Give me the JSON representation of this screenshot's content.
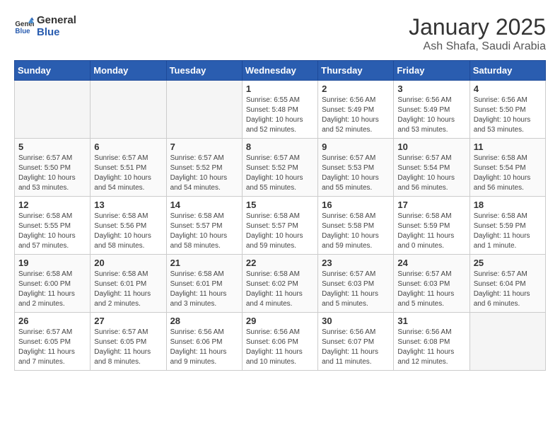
{
  "logo": {
    "line1": "General",
    "line2": "Blue"
  },
  "title": "January 2025",
  "location": "Ash Shafa, Saudi Arabia",
  "weekdays": [
    "Sunday",
    "Monday",
    "Tuesday",
    "Wednesday",
    "Thursday",
    "Friday",
    "Saturday"
  ],
  "weeks": [
    [
      {
        "day": "",
        "info": ""
      },
      {
        "day": "",
        "info": ""
      },
      {
        "day": "",
        "info": ""
      },
      {
        "day": "1",
        "info": "Sunrise: 6:55 AM\nSunset: 5:48 PM\nDaylight: 10 hours\nand 52 minutes."
      },
      {
        "day": "2",
        "info": "Sunrise: 6:56 AM\nSunset: 5:49 PM\nDaylight: 10 hours\nand 52 minutes."
      },
      {
        "day": "3",
        "info": "Sunrise: 6:56 AM\nSunset: 5:49 PM\nDaylight: 10 hours\nand 53 minutes."
      },
      {
        "day": "4",
        "info": "Sunrise: 6:56 AM\nSunset: 5:50 PM\nDaylight: 10 hours\nand 53 minutes."
      }
    ],
    [
      {
        "day": "5",
        "info": "Sunrise: 6:57 AM\nSunset: 5:50 PM\nDaylight: 10 hours\nand 53 minutes."
      },
      {
        "day": "6",
        "info": "Sunrise: 6:57 AM\nSunset: 5:51 PM\nDaylight: 10 hours\nand 54 minutes."
      },
      {
        "day": "7",
        "info": "Sunrise: 6:57 AM\nSunset: 5:52 PM\nDaylight: 10 hours\nand 54 minutes."
      },
      {
        "day": "8",
        "info": "Sunrise: 6:57 AM\nSunset: 5:52 PM\nDaylight: 10 hours\nand 55 minutes."
      },
      {
        "day": "9",
        "info": "Sunrise: 6:57 AM\nSunset: 5:53 PM\nDaylight: 10 hours\nand 55 minutes."
      },
      {
        "day": "10",
        "info": "Sunrise: 6:57 AM\nSunset: 5:54 PM\nDaylight: 10 hours\nand 56 minutes."
      },
      {
        "day": "11",
        "info": "Sunrise: 6:58 AM\nSunset: 5:54 PM\nDaylight: 10 hours\nand 56 minutes."
      }
    ],
    [
      {
        "day": "12",
        "info": "Sunrise: 6:58 AM\nSunset: 5:55 PM\nDaylight: 10 hours\nand 57 minutes."
      },
      {
        "day": "13",
        "info": "Sunrise: 6:58 AM\nSunset: 5:56 PM\nDaylight: 10 hours\nand 58 minutes."
      },
      {
        "day": "14",
        "info": "Sunrise: 6:58 AM\nSunset: 5:57 PM\nDaylight: 10 hours\nand 58 minutes."
      },
      {
        "day": "15",
        "info": "Sunrise: 6:58 AM\nSunset: 5:57 PM\nDaylight: 10 hours\nand 59 minutes."
      },
      {
        "day": "16",
        "info": "Sunrise: 6:58 AM\nSunset: 5:58 PM\nDaylight: 10 hours\nand 59 minutes."
      },
      {
        "day": "17",
        "info": "Sunrise: 6:58 AM\nSunset: 5:59 PM\nDaylight: 11 hours\nand 0 minutes."
      },
      {
        "day": "18",
        "info": "Sunrise: 6:58 AM\nSunset: 5:59 PM\nDaylight: 11 hours\nand 1 minute."
      }
    ],
    [
      {
        "day": "19",
        "info": "Sunrise: 6:58 AM\nSunset: 6:00 PM\nDaylight: 11 hours\nand 2 minutes."
      },
      {
        "day": "20",
        "info": "Sunrise: 6:58 AM\nSunset: 6:01 PM\nDaylight: 11 hours\nand 2 minutes."
      },
      {
        "day": "21",
        "info": "Sunrise: 6:58 AM\nSunset: 6:01 PM\nDaylight: 11 hours\nand 3 minutes."
      },
      {
        "day": "22",
        "info": "Sunrise: 6:58 AM\nSunset: 6:02 PM\nDaylight: 11 hours\nand 4 minutes."
      },
      {
        "day": "23",
        "info": "Sunrise: 6:57 AM\nSunset: 6:03 PM\nDaylight: 11 hours\nand 5 minutes."
      },
      {
        "day": "24",
        "info": "Sunrise: 6:57 AM\nSunset: 6:03 PM\nDaylight: 11 hours\nand 5 minutes."
      },
      {
        "day": "25",
        "info": "Sunrise: 6:57 AM\nSunset: 6:04 PM\nDaylight: 11 hours\nand 6 minutes."
      }
    ],
    [
      {
        "day": "26",
        "info": "Sunrise: 6:57 AM\nSunset: 6:05 PM\nDaylight: 11 hours\nand 7 minutes."
      },
      {
        "day": "27",
        "info": "Sunrise: 6:57 AM\nSunset: 6:05 PM\nDaylight: 11 hours\nand 8 minutes."
      },
      {
        "day": "28",
        "info": "Sunrise: 6:56 AM\nSunset: 6:06 PM\nDaylight: 11 hours\nand 9 minutes."
      },
      {
        "day": "29",
        "info": "Sunrise: 6:56 AM\nSunset: 6:06 PM\nDaylight: 11 hours\nand 10 minutes."
      },
      {
        "day": "30",
        "info": "Sunrise: 6:56 AM\nSunset: 6:07 PM\nDaylight: 11 hours\nand 11 minutes."
      },
      {
        "day": "31",
        "info": "Sunrise: 6:56 AM\nSunset: 6:08 PM\nDaylight: 11 hours\nand 12 minutes."
      },
      {
        "day": "",
        "info": ""
      }
    ]
  ]
}
